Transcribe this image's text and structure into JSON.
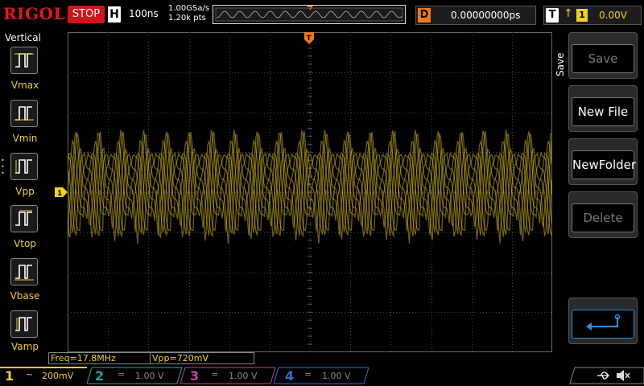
{
  "brand": "RIGOL",
  "run_state": "STOP",
  "horizontal": {
    "letter": "H",
    "timebase": "100ns"
  },
  "acquisition": {
    "sample_rate": "1.00GSa/s",
    "points": "1.20k pts"
  },
  "delay": {
    "letter": "D",
    "value": "0.00000000ps"
  },
  "trigger": {
    "letter": "T",
    "source": "1",
    "level": "0.00V"
  },
  "left_menu": {
    "title": "Vertical",
    "items": [
      {
        "label": "Vmax"
      },
      {
        "label": "Vmin"
      },
      {
        "label": "Vpp"
      },
      {
        "label": "Vtop"
      },
      {
        "label": "Vbase"
      },
      {
        "label": "Vamp"
      }
    ]
  },
  "right_menu": {
    "title": "Save",
    "items": [
      {
        "label": "Save",
        "enabled": false
      },
      {
        "label": "New File",
        "enabled": true
      },
      {
        "label": "NewFolder",
        "enabled": true
      },
      {
        "label": "Delete",
        "enabled": false
      }
    ]
  },
  "measurements": {
    "freq": "Freq=17.8MHz",
    "vpp": "Vpp=720mV"
  },
  "channels": [
    {
      "num": "1",
      "coupling": "~",
      "scale": "200mV",
      "color": "#f0d020",
      "active": true
    },
    {
      "num": "2",
      "coupling": "=",
      "scale": "1.00 V",
      "color": "#1fa3a8",
      "active": false
    },
    {
      "num": "3",
      "coupling": "=",
      "scale": "1.00 V",
      "color": "#c83fa0",
      "active": false
    },
    {
      "num": "4",
      "coupling": "=",
      "scale": "1.00 V",
      "color": "#2c6fd0",
      "active": false
    }
  ],
  "markers": {
    "channel_marker": "1",
    "trigger_marker": "T"
  },
  "colors": {
    "trace": "#f0d020",
    "trigger": "#f07a1a",
    "stop": "#d1141b"
  }
}
